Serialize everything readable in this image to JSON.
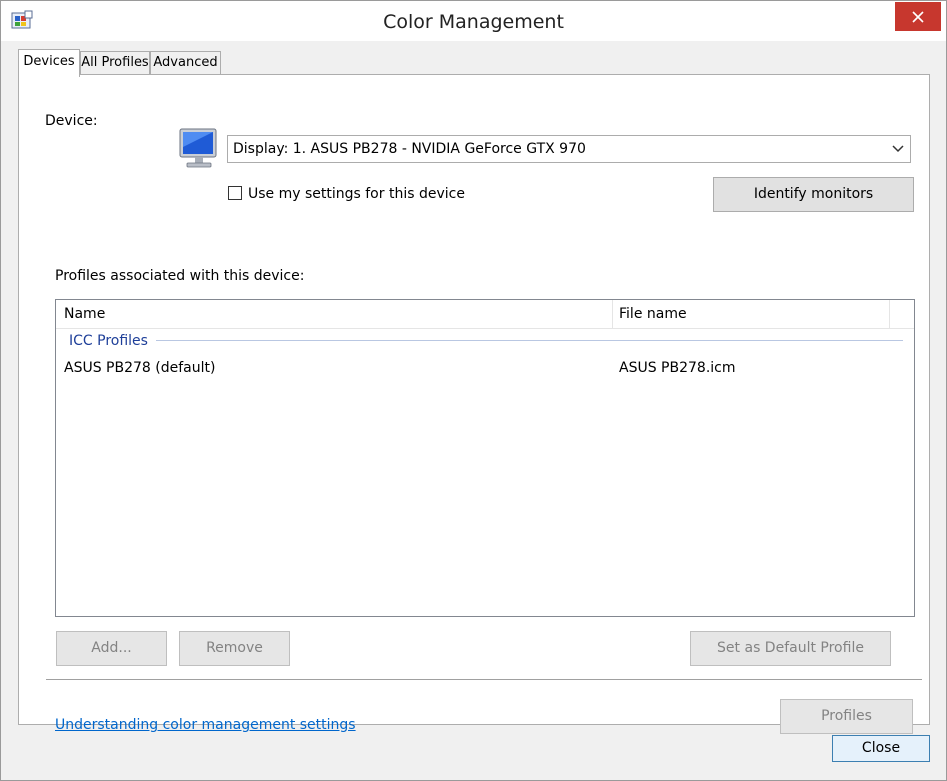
{
  "window": {
    "title": "Color Management"
  },
  "tabs": [
    {
      "label": "Devices",
      "active": true
    },
    {
      "label": "All Profiles",
      "active": false
    },
    {
      "label": "Advanced",
      "active": false
    }
  ],
  "device": {
    "label": "Device:",
    "selected": "Display: 1. ASUS PB278 - NVIDIA GeForce GTX 970",
    "use_settings_label": "Use my settings for this device",
    "use_settings_checked": false,
    "identify_button": "Identify monitors"
  },
  "profiles": {
    "label": "Profiles associated with this device:",
    "columns": [
      "Name",
      "File name"
    ],
    "group": "ICC Profiles",
    "rows": [
      {
        "name": "ASUS PB278 (default)",
        "file": "ASUS PB278.icm"
      }
    ]
  },
  "buttons": {
    "add": "Add...",
    "remove": "Remove",
    "set_default": "Set as Default Profile",
    "profiles": "Profiles",
    "close": "Close"
  },
  "link": "Understanding color management settings",
  "colors": {
    "close_button_red": "#c7372e",
    "link_blue": "#0066cc",
    "group_blue": "#1e3f99"
  }
}
